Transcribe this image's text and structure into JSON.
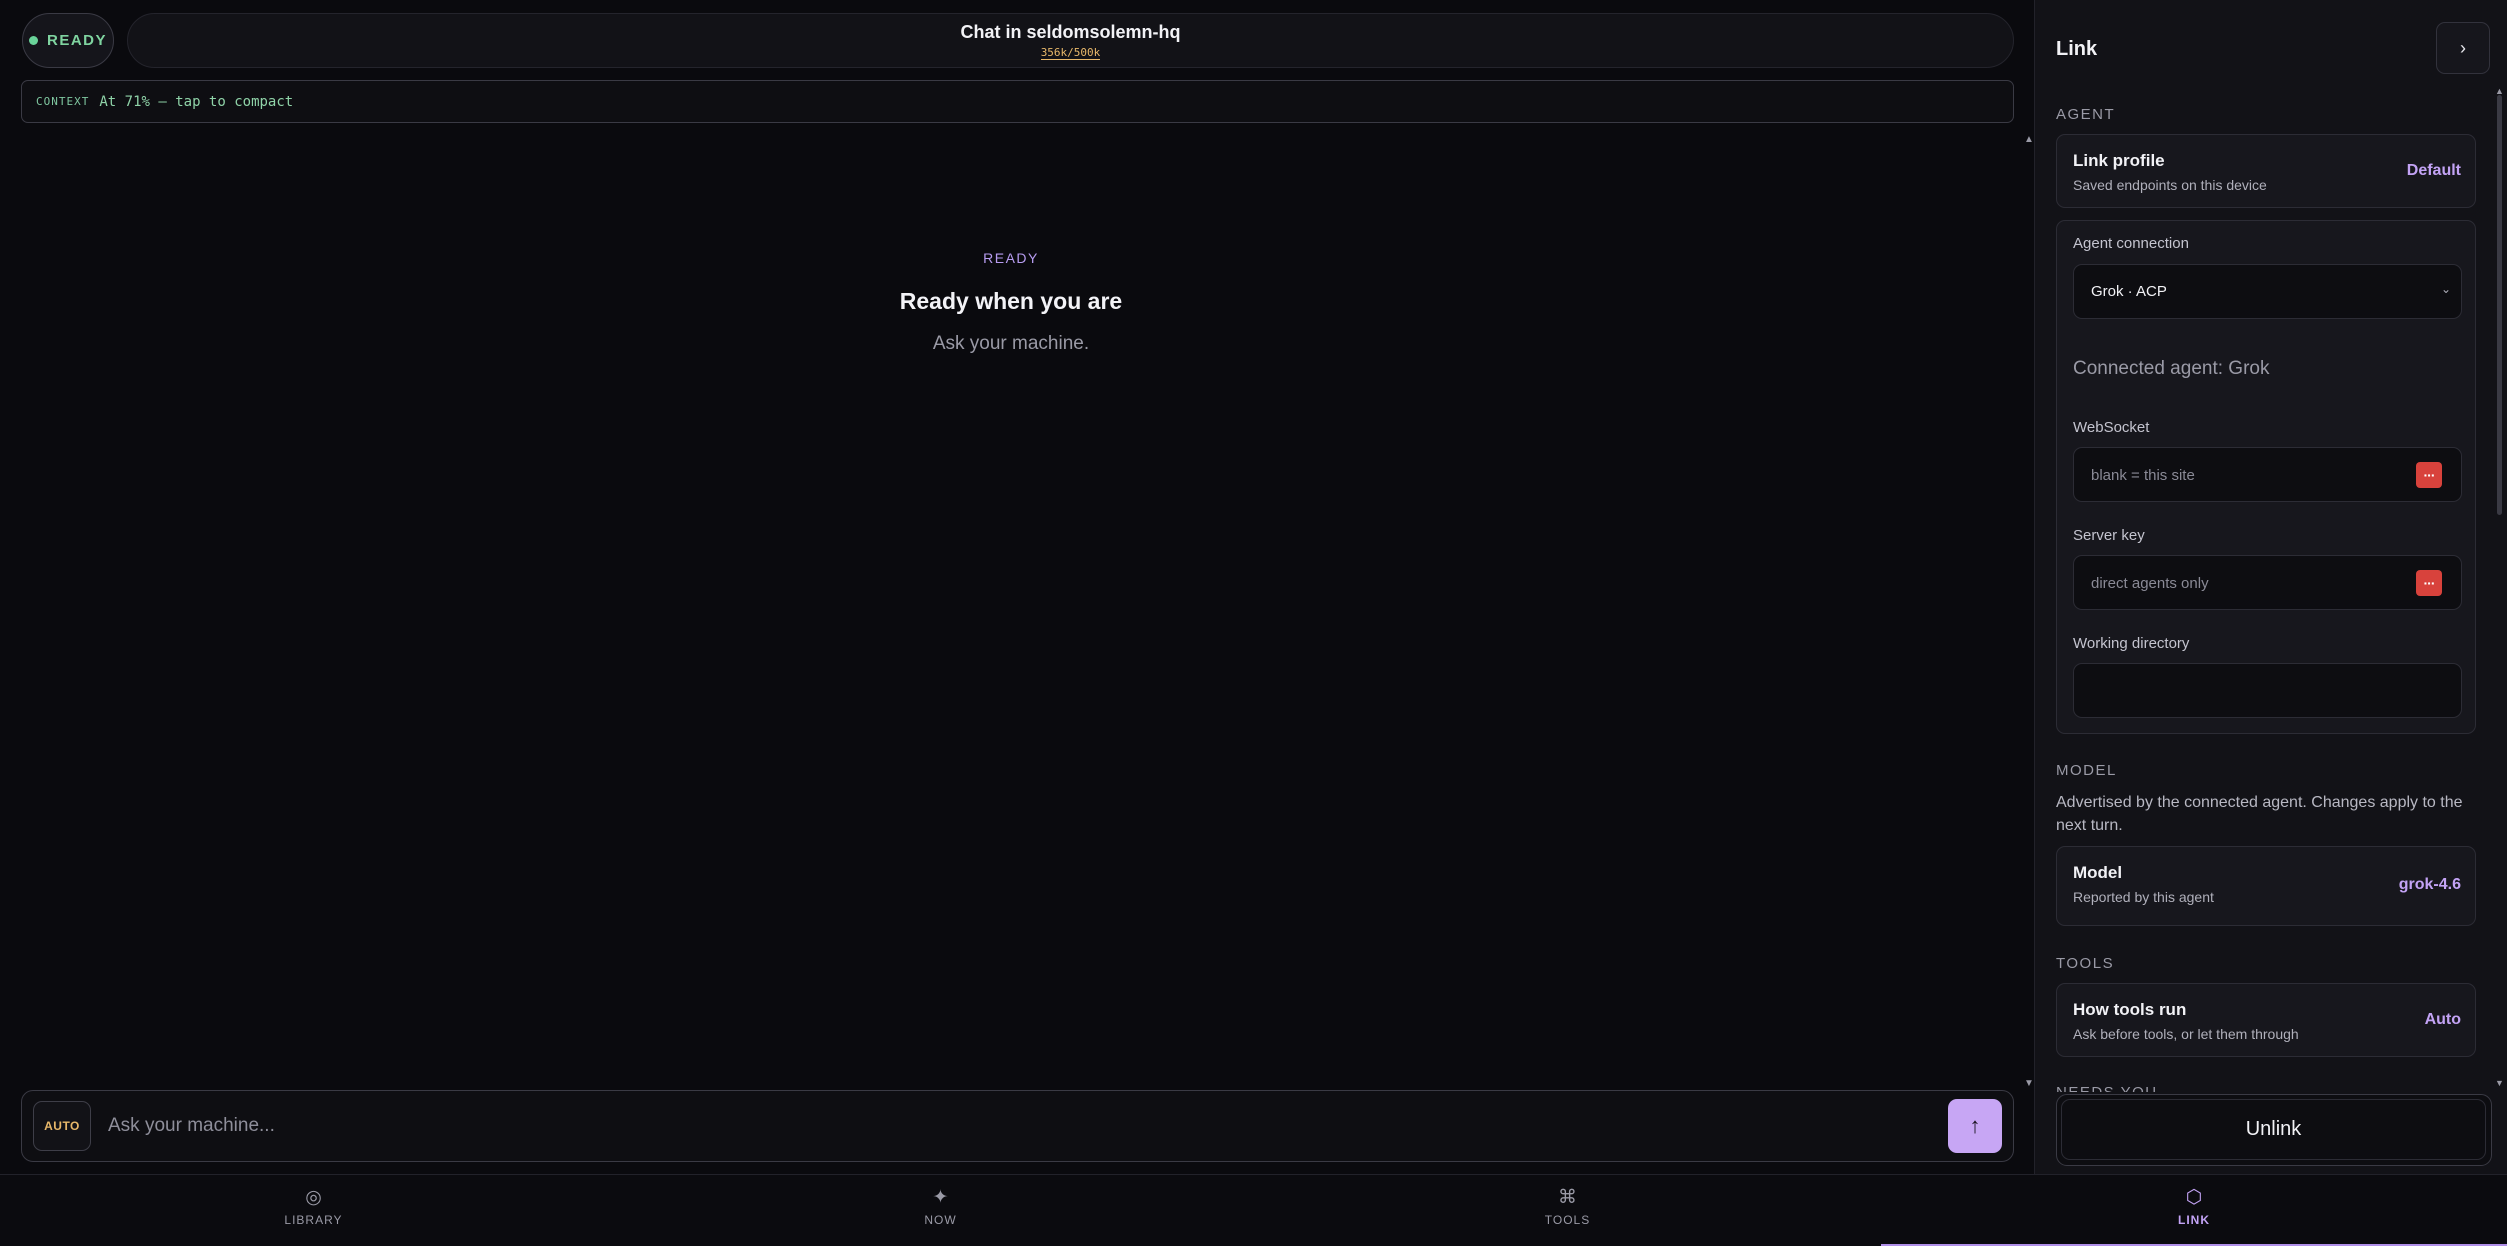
{
  "header": {
    "status": "READY",
    "title": "Chat in seldomsolemn-hq",
    "token_usage": "356k/500k"
  },
  "context_bar": {
    "label": "CONTEXT",
    "text": "At 71% — tap to compact"
  },
  "empty_state": {
    "kicker": "READY",
    "title": "Ready when you are",
    "subtitle": "Ask your machine."
  },
  "composer": {
    "mode": "AUTO",
    "placeholder": "Ask your machine...",
    "send_icon": "arrow-up-icon"
  },
  "nav": {
    "items": [
      {
        "icon": "◎",
        "label": "LIBRARY"
      },
      {
        "icon": "✦",
        "label": "NOW"
      },
      {
        "icon": "⌘",
        "label": "TOOLS"
      },
      {
        "icon": "⬡",
        "label": "LINK"
      }
    ],
    "active": "LINK"
  },
  "panel": {
    "title": "Link",
    "close_icon": "chevron-right-icon",
    "agent_section": "AGENT",
    "link_profile": {
      "title": "Link profile",
      "subtitle": "Saved endpoints on this device",
      "value": "Default"
    },
    "agent_connection": {
      "label": "Agent connection",
      "selected": "Grok · ACP",
      "connected_text": "Connected agent: Grok",
      "websocket_label": "WebSocket",
      "websocket_placeholder": "blank = this site",
      "server_key_label": "Server key",
      "server_key_placeholder": "direct agents only",
      "working_dir_label": "Working directory",
      "working_dir_value": ""
    },
    "model_section": "MODEL",
    "model_desc": "Advertised by the connected agent. Changes apply to the next turn.",
    "model_card": {
      "title": "Model",
      "subtitle": "Reported by this agent",
      "value": "grok-4.6"
    },
    "tools_section": "TOOLS",
    "tools_card": {
      "title": "How tools run",
      "subtitle": "Ask before tools, or let them through",
      "value": "Auto"
    },
    "cutoff_section": "NEEDS YOU",
    "unlink_label": "Unlink"
  },
  "colors": {
    "accent": "#c3a3f5",
    "ready_green": "#7fd4a0",
    "warning_amber": "#e8b86a",
    "key_red": "#d8423c"
  }
}
